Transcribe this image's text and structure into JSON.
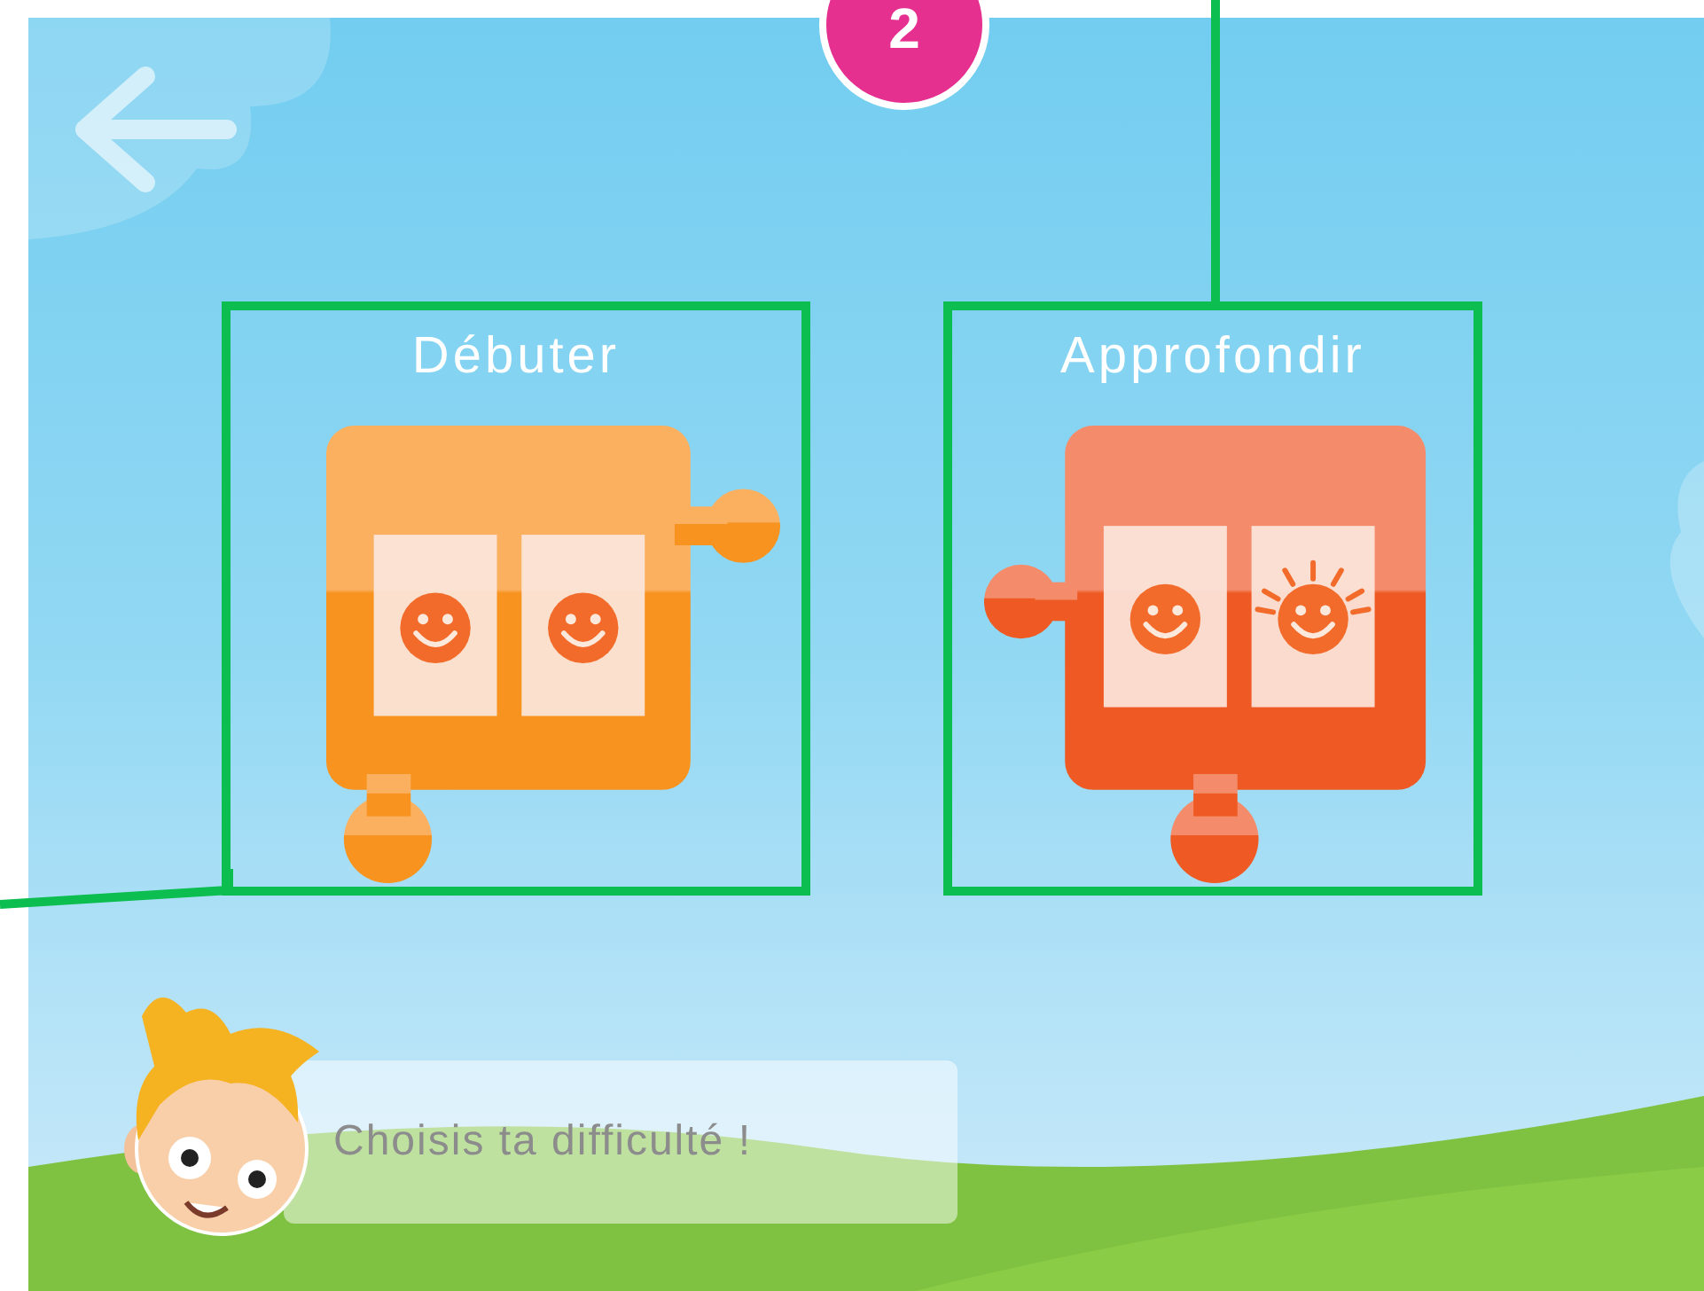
{
  "annotation": {
    "badge": "2"
  },
  "options": [
    {
      "title": "Débuter",
      "kind": "start",
      "highlighted": true,
      "tiles": [
        {
          "kind": "smiley"
        },
        {
          "kind": "smiley"
        }
      ]
    },
    {
      "title": "Approfondir",
      "kind": "deepen",
      "highlighted": true,
      "tiles": [
        {
          "kind": "smiley"
        },
        {
          "kind": "sun"
        }
      ]
    }
  ],
  "hint": {
    "text": "Choisis ta difficulté !"
  }
}
